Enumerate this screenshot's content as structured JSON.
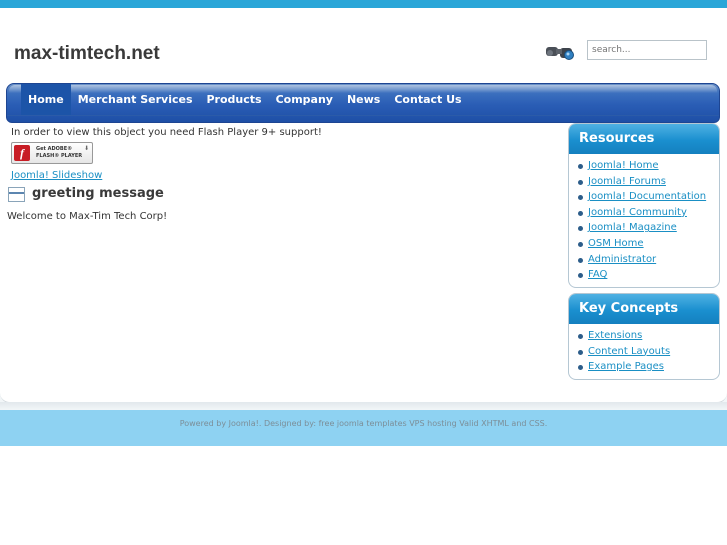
{
  "site": {
    "title": "max-timtech.net"
  },
  "search": {
    "placeholder": "search..."
  },
  "nav": {
    "items": [
      {
        "label": "Home",
        "active": true
      },
      {
        "label": "Merchant Services",
        "active": false
      },
      {
        "label": "Products",
        "active": false
      },
      {
        "label": "Company",
        "active": false
      },
      {
        "label": "News",
        "active": false
      },
      {
        "label": "Contact Us",
        "active": false
      }
    ]
  },
  "main": {
    "flash_note": "In order to view this object you need Flash Player 9+ support!",
    "flash_badge": {
      "line1": "Get ADOBE®",
      "line2": "FLASH® PLAYER",
      "letter": "f"
    },
    "slideshow_link": "Joomla! Slideshow",
    "greeting_title": "greeting message",
    "welcome_text": "Welcome to Max-Tim Tech Corp!"
  },
  "resources": {
    "title": "Resources",
    "items": [
      "Joomla! Home",
      "Joomla! Forums",
      "Joomla! Documentation",
      "Joomla! Community",
      "Joomla! Magazine",
      "OSM Home",
      "Administrator",
      "FAQ"
    ]
  },
  "key_concepts": {
    "title": "Key Concepts",
    "items": [
      "Extensions",
      "Content Layouts",
      "Example Pages"
    ]
  },
  "footer": {
    "text": "Powered by Joomla!. Designed by: free joomla templates VPS hosting Valid XHTML and CSS."
  },
  "colors": {
    "top_bar": "#2aa6d8",
    "nav_blue": "#2a5db5",
    "module_head": "#1a8fcf",
    "link": "#1a8fc4",
    "footer_bg": "#8ed2f2"
  },
  "icons": {
    "search": "binoculars-icon",
    "greeting": "article-icon",
    "bullet": "bullet-dot-icon"
  }
}
